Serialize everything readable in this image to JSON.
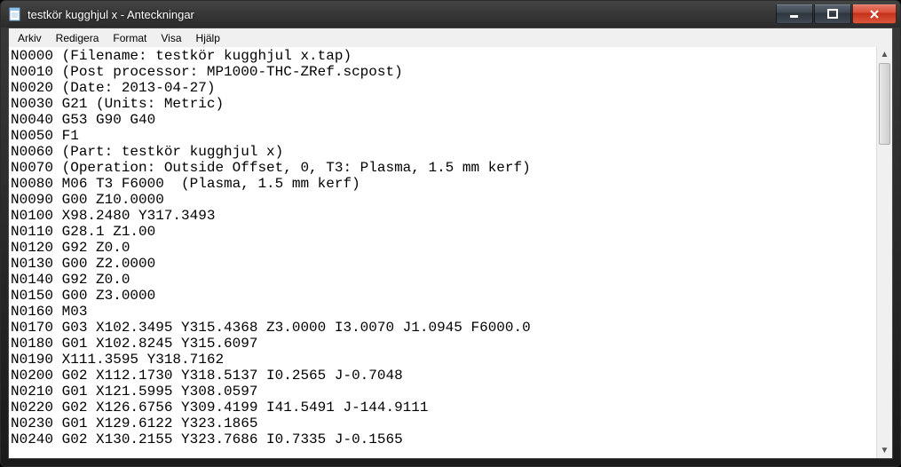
{
  "window": {
    "title": "testkör kugghjul x - Anteckningar"
  },
  "menu": {
    "items": [
      "Arkiv",
      "Redigera",
      "Format",
      "Visa",
      "Hjälp"
    ]
  },
  "editor": {
    "lines": [
      "N0000 (Filename: testkör kugghjul x.tap)",
      "N0010 (Post processor: MP1000-THC-ZRef.scpost)",
      "N0020 (Date: 2013-04-27)",
      "N0030 G21 (Units: Metric)",
      "N0040 G53 G90 G40",
      "N0050 F1",
      "N0060 (Part: testkör kugghjul x)",
      "N0070 (Operation: Outside Offset, 0, T3: Plasma, 1.5 mm kerf)",
      "N0080 M06 T3 F6000  (Plasma, 1.5 mm kerf)",
      "N0090 G00 Z10.0000",
      "N0100 X98.2480 Y317.3493",
      "N0110 G28.1 Z1.00",
      "N0120 G92 Z0.0",
      "N0130 G00 Z2.0000",
      "N0140 G92 Z0.0",
      "N0150 G00 Z3.0000",
      "N0160 M03",
      "N0170 G03 X102.3495 Y315.4368 Z3.0000 I3.0070 J1.0945 F6000.0",
      "N0180 G01 X102.8245 Y315.6097",
      "N0190 X111.3595 Y318.7162",
      "N0200 G02 X112.1730 Y318.5137 I0.2565 J-0.7048",
      "N0210 G01 X121.5995 Y308.0597",
      "N0220 G02 X126.6756 Y309.4199 I41.5491 J-144.9111",
      "N0230 G01 X129.6122 Y323.1865",
      "N0240 G02 X130.2155 Y323.7686 I0.7335 J-0.1565"
    ]
  }
}
